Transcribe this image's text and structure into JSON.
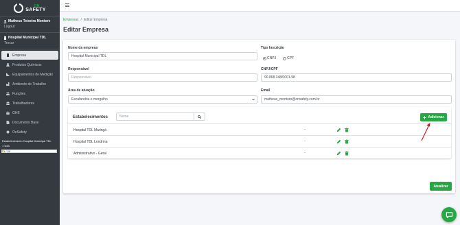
{
  "brand": {
    "line1": "ON",
    "line2": "SAFETY"
  },
  "user": {
    "name": "Matheus Teixeira Montore",
    "logout": "Logout"
  },
  "organization": {
    "name": "Hospital Municipal TDL",
    "switch": "Trocar"
  },
  "sidebar": {
    "items": [
      {
        "label": "Empresa",
        "icon": "building-icon",
        "active": true
      },
      {
        "label": "Produtos Químicos",
        "icon": "flask-icon",
        "active": false
      },
      {
        "label": "Equipamentos de Medição",
        "icon": "ruler-icon",
        "active": false
      },
      {
        "label": "Ambiente de Trabalho",
        "icon": "factory-icon",
        "active": false
      },
      {
        "label": "Funções",
        "icon": "users-icon",
        "active": false
      },
      {
        "label": "Trabalhadores",
        "icon": "workers-icon",
        "active": false
      },
      {
        "label": "GHE",
        "icon": "group-icon",
        "active": false
      },
      {
        "label": "Documento Base",
        "icon": "document-icon",
        "active": false
      },
      {
        "label": "OnSafety",
        "icon": "circle-icon",
        "active": false
      }
    ]
  },
  "estab_info": {
    "line": "Estabelecimento Hospital Municipal TDL",
    "vida": "1 vida",
    "life_text": "1 / 50",
    "life_fraction": 0.02
  },
  "breadcrumb": {
    "link": "Empresas",
    "separator": "/",
    "current": "Editar Empresa"
  },
  "page_title": "Editar Empresa",
  "form": {
    "nome_label": "Nome da empresa",
    "nome_value": "Hospital Municipal TDL",
    "tipo_label": "Tipo Inscrição",
    "tipo_options": [
      "CNPJ",
      "CPF"
    ],
    "tipo_selected": "CNPJ",
    "responsavel_label": "Responsável",
    "responsavel_placeholder": "Responsável",
    "cnpj_label": "CNPJ/CPF",
    "cnpj_value": "90.868.348/0001-98",
    "area_label": "Área de atuação",
    "area_value": "Escafandria e mergulho",
    "email_label": "Email",
    "email_value": "matheus_montoro@onsafety.com.br"
  },
  "estabelecimentos": {
    "title": "Estabelecimentos",
    "search_placeholder": "Nome",
    "add_label": "Adicionar",
    "rows": [
      {
        "name": "Hospital TDL Maringá",
        "value": "-"
      },
      {
        "name": "Hospital TDL Londrina",
        "value": "-"
      },
      {
        "name": "Administrativo - Geral",
        "value": "-"
      }
    ]
  },
  "update_label": "Atualizar",
  "colors": {
    "sidebar": "#343a40",
    "accent": "#28a745",
    "arrow": "#c0201e"
  }
}
